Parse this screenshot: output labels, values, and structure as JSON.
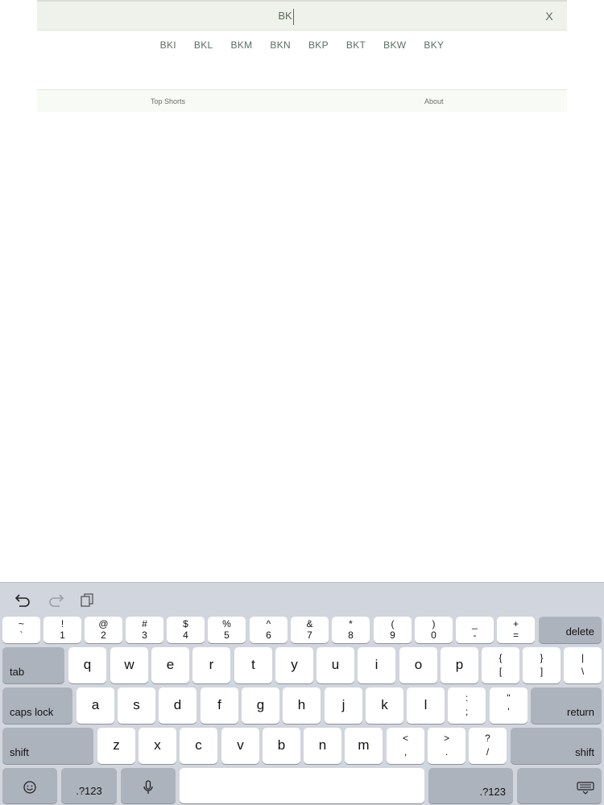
{
  "search": {
    "value": "BK"
  },
  "clear_label": "X",
  "suggestions": [
    "BKI",
    "BKL",
    "BKM",
    "BKN",
    "BKP",
    "BKT",
    "BKW",
    "BKY"
  ],
  "footer": {
    "top_shorts": "Top Shorts",
    "about": "About"
  },
  "keyboard": {
    "row1": [
      {
        "top": "~",
        "bot": "`"
      },
      {
        "top": "!",
        "bot": "1"
      },
      {
        "top": "@",
        "bot": "2"
      },
      {
        "top": "#",
        "bot": "3"
      },
      {
        "top": "$",
        "bot": "4"
      },
      {
        "top": "%",
        "bot": "5"
      },
      {
        "top": "^",
        "bot": "6"
      },
      {
        "top": "&",
        "bot": "7"
      },
      {
        "top": "*",
        "bot": "8"
      },
      {
        "top": "(",
        "bot": "9"
      },
      {
        "top": ")",
        "bot": "0"
      },
      {
        "top": "_",
        "bot": "-"
      },
      {
        "top": "+",
        "bot": "="
      }
    ],
    "delete": "delete",
    "tab": "tab",
    "row2": [
      "q",
      "w",
      "e",
      "r",
      "t",
      "y",
      "u",
      "i",
      "o",
      "p"
    ],
    "row2_sym": [
      {
        "top": "{",
        "bot": "["
      },
      {
        "top": "}",
        "bot": "]"
      },
      {
        "top": "|",
        "bot": "\\"
      }
    ],
    "caps_lock": "caps lock",
    "row3": [
      "a",
      "s",
      "d",
      "f",
      "g",
      "h",
      "j",
      "k",
      "l"
    ],
    "row3_sym": [
      {
        "top": ":",
        "bot": ";"
      },
      {
        "top": "\"",
        "bot": "'"
      }
    ],
    "return": "return",
    "shift": "shift",
    "row4": [
      "z",
      "x",
      "c",
      "v",
      "b",
      "n",
      "m"
    ],
    "row4_sym": [
      {
        "top": "<",
        "bot": ","
      },
      {
        "top": ">",
        "bot": "."
      },
      {
        "top": "?",
        "bot": "/"
      }
    ],
    "num_label": ".?123",
    "icons": {
      "undo": "undo-icon",
      "redo": "redo-icon",
      "paste": "paste-icon",
      "emoji": "emoji-icon",
      "mic": "microphone-icon",
      "hide": "keyboard-hide-icon"
    }
  }
}
